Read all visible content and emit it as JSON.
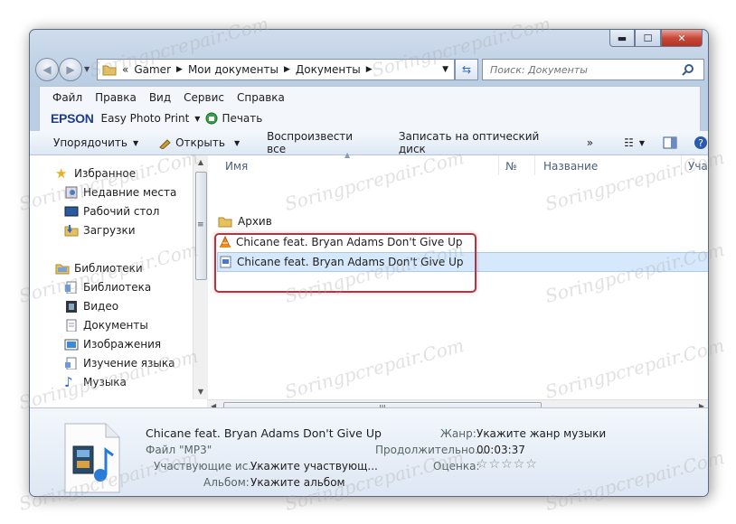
{
  "address": {
    "overflow": "«",
    "segments": [
      "Gamer",
      "Мои документы",
      "Документы"
    ]
  },
  "search": {
    "placeholder": "Поиск: Документы"
  },
  "menu": [
    "Файл",
    "Правка",
    "Вид",
    "Сервис",
    "Справка"
  ],
  "epson": {
    "brand": "EPSON",
    "app": "Easy Photo Print",
    "print": "Печать"
  },
  "toolbar": {
    "organize": "Упорядочить",
    "open": "Открыть",
    "play_all": "Воспроизвести все",
    "burn": "Записать на оптический диск",
    "more": "»"
  },
  "navpane": {
    "favorites": "Избранное",
    "recent": "Недавние места",
    "desktop": "Рабочий стол",
    "downloads": "Загрузки",
    "libraries": "Библиотеки",
    "library": "Библиотека",
    "video": "Видео",
    "documents": "Документы",
    "images": "Изображения",
    "language": "Изучение языка",
    "music": "Музыка"
  },
  "columns": {
    "name": "Имя",
    "num": "№",
    "title": "Название",
    "artist": "Уча"
  },
  "files": [
    {
      "name": "Архив",
      "type": "folder"
    },
    {
      "name": "Chicane feat. Bryan Adams Don't Give Up",
      "type": "vlc"
    },
    {
      "name": "Chicane feat. Bryan Adams Don't Give Up",
      "type": "mp3"
    }
  ],
  "details": {
    "filename": "Chicane feat. Bryan Adams Don't Give Up",
    "filetype": "Файл \"MP3\"",
    "artists_label": "Участвующие ис...",
    "artists_value": "Укажите участвующ...",
    "album_label": "Альбом:",
    "album_value": "Укажите альбом",
    "genre_label": "Жанр:",
    "genre_value": "Укажите жанр музыки",
    "duration_label": "Продолжительно...",
    "duration_value": "00:03:37",
    "rating_label": "Оценка:",
    "rating_value": "☆☆☆☆☆"
  },
  "watermark": "Soringpcrepair.Com",
  "colors": {
    "selection": "#d6e8fb",
    "highlight_border": "#a63b45",
    "brand": "#1f3c8e"
  }
}
